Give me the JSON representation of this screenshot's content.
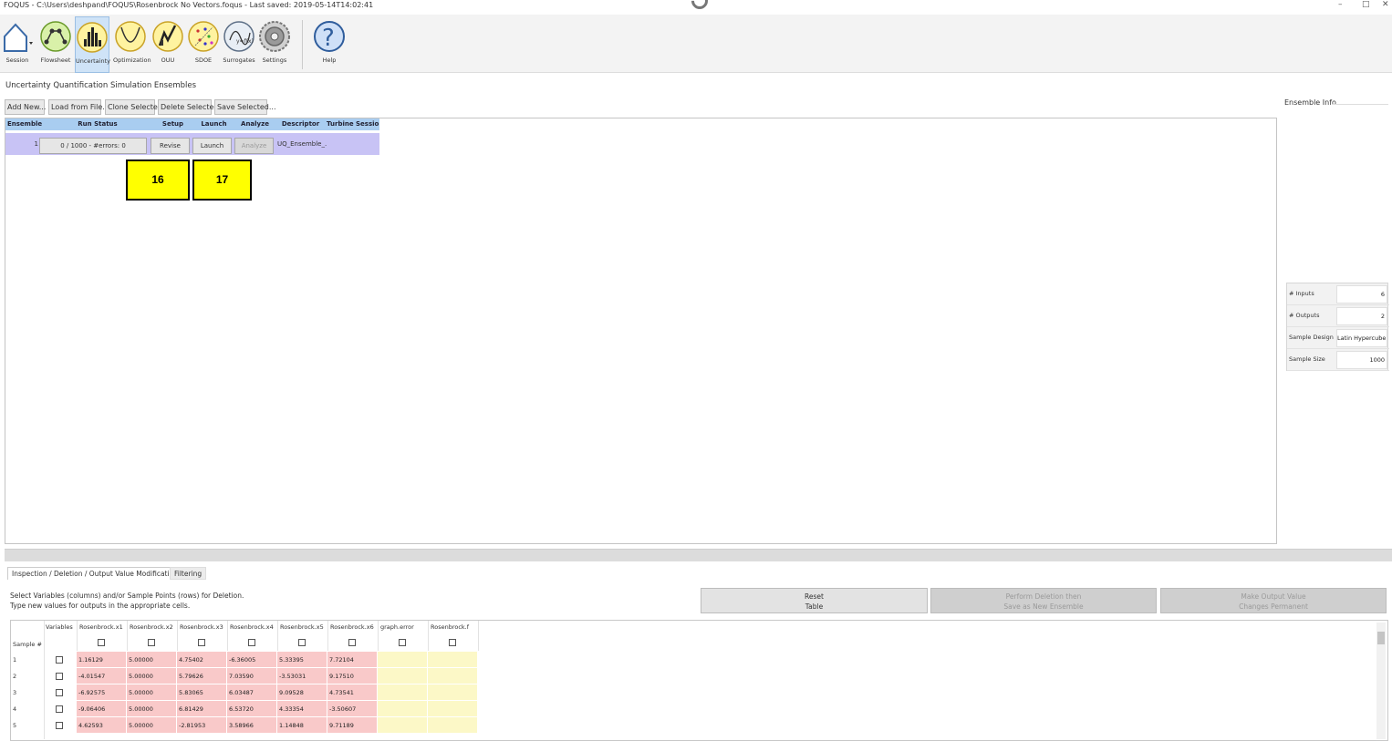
{
  "window": {
    "title": "FOQUS - C:\\Users\\deshpand\\FOQUS\\Rosenbrock No Vectors.foqus - Last saved: 2019-05-14T14:02:41",
    "minimize": "–",
    "maximize": "□",
    "close": "✕"
  },
  "toolbar": {
    "items": [
      {
        "label": "Session"
      },
      {
        "label": "Flowsheet"
      },
      {
        "label": "Uncertainty"
      },
      {
        "label": "Optimization"
      },
      {
        "label": "OUU"
      },
      {
        "label": "SDOE"
      },
      {
        "label": "Surrogates"
      },
      {
        "label": "Settings"
      },
      {
        "label": "Help"
      }
    ]
  },
  "section_title": "Uncertainty Quantification Simulation Ensembles",
  "actions": {
    "add_new": "Add New...",
    "load_from_file": "Load from File...",
    "clone_selected": "Clone Selected",
    "delete_selected": "Delete Selected",
    "save_selected": "Save Selected..."
  },
  "ensemble_table": {
    "headers": [
      "Ensemble",
      "Run Status",
      "Setup",
      "Launch",
      "Analyze",
      "Descriptor",
      "Turbine Session"
    ],
    "row": {
      "ensemble": "1",
      "run_status": "0 / 1000 - #errors: 0",
      "setup": "Revise",
      "launch": "Launch",
      "analyze": "Analyze",
      "descriptor": "UQ_Ensemble_...",
      "turbine_session": ""
    }
  },
  "markers": {
    "m16": "16",
    "m17": "17"
  },
  "ensemble_info": {
    "label": "Ensemble Info",
    "rows": [
      {
        "key": "# Inputs",
        "value": "6"
      },
      {
        "key": "# Outputs",
        "value": "2"
      },
      {
        "key": "Sample Design",
        "value": "Latin Hypercube"
      },
      {
        "key": "Sample Size",
        "value": "1000"
      }
    ]
  },
  "tabs": {
    "inspection": "Inspection / Deletion / Output Value Modification",
    "filtering": "Filtering"
  },
  "instructions": {
    "line1": "Select Variables (columns) and/or Sample Points (rows) for Deletion.",
    "line2": "Type new values for outputs in the appropriate cells."
  },
  "buttons": {
    "reset_l1": "Reset",
    "reset_l2": "Table",
    "perform_l1": "Perform Deletion then",
    "perform_l2": "Save as New Ensemble",
    "make_l1": "Make Output Value",
    "make_l2": "Changes Permanent"
  },
  "grid": {
    "sample_header": "Sample #",
    "variables_header": "Variables",
    "columns": [
      "Rosenbrock.x1",
      "Rosenbrock.x2",
      "Rosenbrock.x3",
      "Rosenbrock.x4",
      "Rosenbrock.x5",
      "Rosenbrock.x6",
      "graph.error",
      "Rosenbrock.f"
    ],
    "rows": [
      {
        "n": "1",
        "v": [
          "1.16129",
          "5.00000",
          "4.75402",
          "-6.36005",
          "5.33395",
          "7.72104",
          "",
          ""
        ]
      },
      {
        "n": "2",
        "v": [
          "-4.01547",
          "5.00000",
          "5.79626",
          "7.03590",
          "-3.53031",
          "9.17510",
          "",
          ""
        ]
      },
      {
        "n": "3",
        "v": [
          "-6.92575",
          "5.00000",
          "5.83065",
          "6.03487",
          "9.09528",
          "4.73541",
          "",
          ""
        ]
      },
      {
        "n": "4",
        "v": [
          "-9.06406",
          "5.00000",
          "6.81429",
          "6.53720",
          "4.33354",
          "-3.50607",
          "",
          ""
        ]
      },
      {
        "n": "5",
        "v": [
          "4.62593",
          "5.00000",
          "-2.81953",
          "3.58966",
          "1.14848",
          "9.71189",
          "",
          ""
        ]
      }
    ]
  },
  "colors": {
    "input_cell": "#f9c9c9",
    "output_cell": "#fcf8c7",
    "ensemble_row": "#c8c3f5",
    "header": "#a9cdf0",
    "marker": "#ffff00"
  }
}
